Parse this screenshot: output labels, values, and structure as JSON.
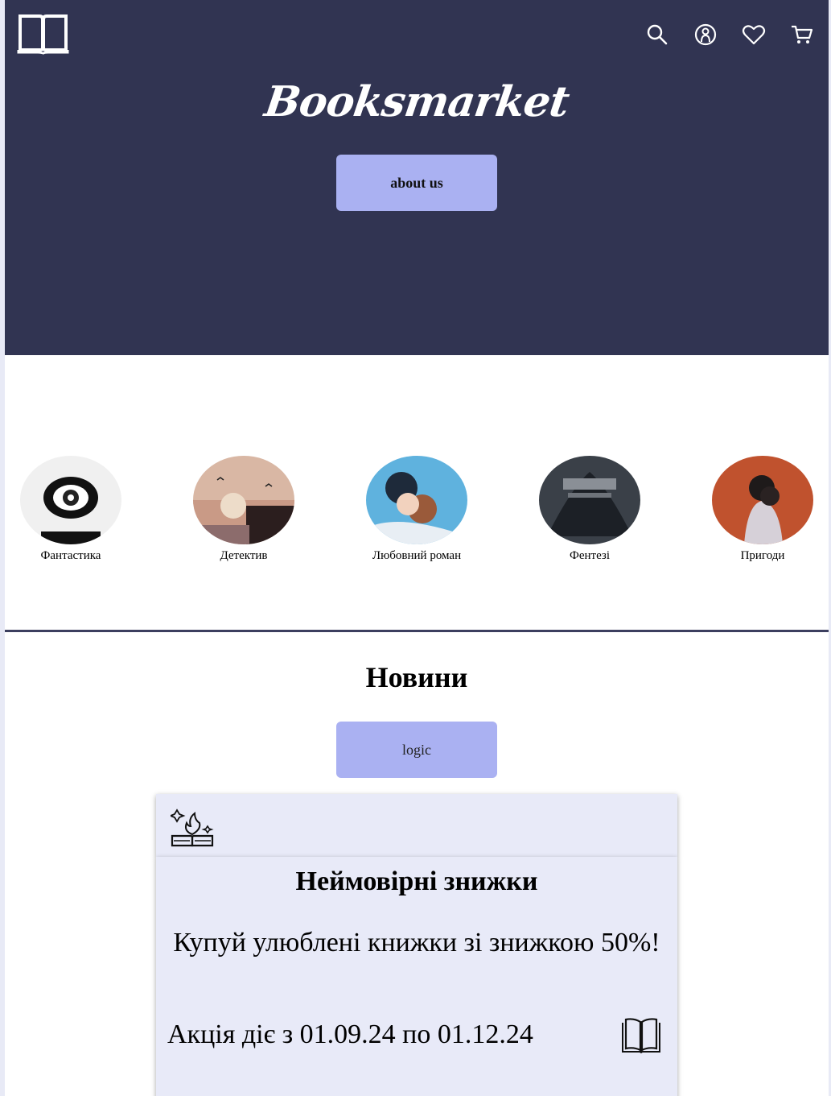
{
  "header": {
    "brand": "Booksmarket",
    "about_button": "about us",
    "icons": [
      "book-logo-icon",
      "search-icon",
      "user-icon",
      "heart-icon",
      "cart-icon"
    ]
  },
  "categories": [
    {
      "label": "Фантастика"
    },
    {
      "label": "Детектив"
    },
    {
      "label": "Любовний роман"
    },
    {
      "label": "Фентезі"
    },
    {
      "label": "Пригоди"
    }
  ],
  "news": {
    "title": "Новини",
    "logic_button": "logic",
    "card": {
      "title": "Неймовірні знижки",
      "subtitle": "Купуй улюблені книжки зі знижкою 50%!",
      "date_text": "Акція діє з 01.09.24 по 01.12.24",
      "icons": [
        "sparkle-book-icon",
        "open-book-icon"
      ]
    }
  },
  "colors": {
    "hero_bg": "#313452",
    "accent_button": "#aab1f2",
    "card_bg": "#e8eaf8"
  }
}
